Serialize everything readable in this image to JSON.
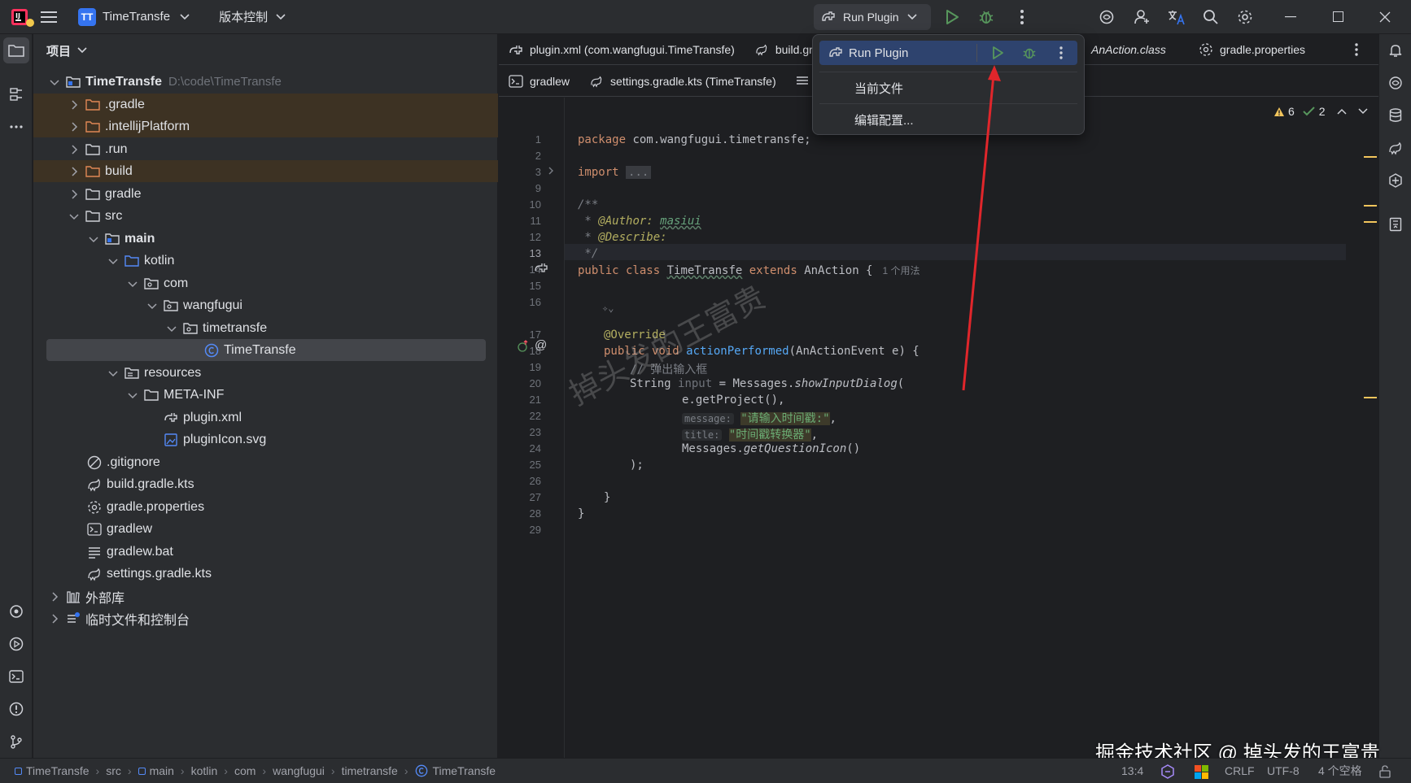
{
  "titlebar": {
    "project_badge": "TT",
    "project_name": "TimeTransfe",
    "vcs_label": "版本控制",
    "run_config": "Run Plugin"
  },
  "project_panel": {
    "title": "项目",
    "root_name": "TimeTransfe",
    "root_path": "D:\\code\\TimeTransfe",
    "items": [
      {
        "label": ".gradle"
      },
      {
        "label": ".intellijPlatform"
      },
      {
        "label": ".run"
      },
      {
        "label": "build"
      },
      {
        "label": "gradle"
      },
      {
        "label": "src"
      },
      {
        "label": "main"
      },
      {
        "label": "kotlin"
      },
      {
        "label": "com"
      },
      {
        "label": "wangfugui"
      },
      {
        "label": "timetransfe"
      },
      {
        "label": "TimeTransfe"
      },
      {
        "label": "resources"
      },
      {
        "label": "META-INF"
      },
      {
        "label": "plugin.xml"
      },
      {
        "label": "pluginIcon.svg"
      },
      {
        "label": ".gitignore"
      },
      {
        "label": "build.gradle.kts"
      },
      {
        "label": "gradle.properties"
      },
      {
        "label": "gradlew"
      },
      {
        "label": "gradlew.bat"
      },
      {
        "label": "settings.gradle.kts"
      },
      {
        "label": "外部库"
      },
      {
        "label": "临时文件和控制台"
      }
    ]
  },
  "tabs": {
    "row1": [
      "plugin.xml (com.wangfugui.TimeTransfe)",
      "build.gra",
      "AnAction.class",
      "gradle.properties"
    ],
    "row2": [
      "gradlew",
      "settings.gradle.kts (TimeTransfe)"
    ]
  },
  "run_popup": {
    "title": "Run Plugin",
    "item_current_file": "当前文件",
    "item_edit_config": "编辑配置..."
  },
  "inspections": {
    "warnings": "6",
    "ok": "2"
  },
  "line_numbers": [
    "1",
    "2",
    "3",
    "9",
    "10",
    "11",
    "12",
    "13",
    "14",
    "15",
    "16",
    "17",
    "18",
    "19",
    "20",
    "21",
    "22",
    "23",
    "24",
    "25",
    "26",
    "27",
    "28",
    "29"
  ],
  "code": {
    "l1_kw": "package",
    "l1_rest": " com.wangfugui.timetransfe;",
    "l3_kw": "import",
    "l3_fold": "...",
    "l10": "/**",
    "l11_pre": " * ",
    "l11_tag": "@Author:",
    "l11_val": "masiui",
    "l12_pre": " * ",
    "l12_tag": "@Describe:",
    "l13": " */",
    "l14_kw1": "public class",
    "l14_name": "TimeTransfe",
    "l14_kw2": "extends",
    "l14_super": "AnAction {",
    "l14_usage": "1 个用法",
    "l17": "@Override",
    "l18_kw": "public void",
    "l18_fn": "actionPerformed",
    "l18_rest": "(AnActionEvent e) {",
    "l19": "// 弹出输入框",
    "l20_type": "String",
    "l20_var": "input",
    "l20_eq": " = Messages.",
    "l20_fn": "showInputDialog",
    "l20_paren": "(",
    "l21": "e.getProject(),",
    "l22_hint": "message:",
    "l22_str": "\"请输入时间戳:\"",
    "l22_comma": ",",
    "l23_hint": "title:",
    "l23_str": "\"时间戳转换器\"",
    "l23_comma": ",",
    "l24_pre": "Messages.",
    "l24_fn": "getQuestionIcon",
    "l24_post": "()",
    "l25": ");",
    "l27": "}",
    "l28": "}"
  },
  "statusbar": {
    "breadcrumb": [
      "TimeTransfe",
      "src",
      "main",
      "kotlin",
      "com",
      "wangfugui",
      "timetransfe",
      "TimeTransfe"
    ],
    "position": "13:4",
    "line_sep": "CRLF",
    "encoding": "UTF-8",
    "indent": "4 个空格"
  },
  "watermarks": {
    "diagonal": "掉头发的王富贵",
    "corner": "掘金技术社区 @ 掉头发的王富贵"
  },
  "colors": {
    "accent": "#3574f0",
    "run_green": "#57965c",
    "arrow_red": "#e0262b",
    "excluded_bg": "#3d3223"
  }
}
